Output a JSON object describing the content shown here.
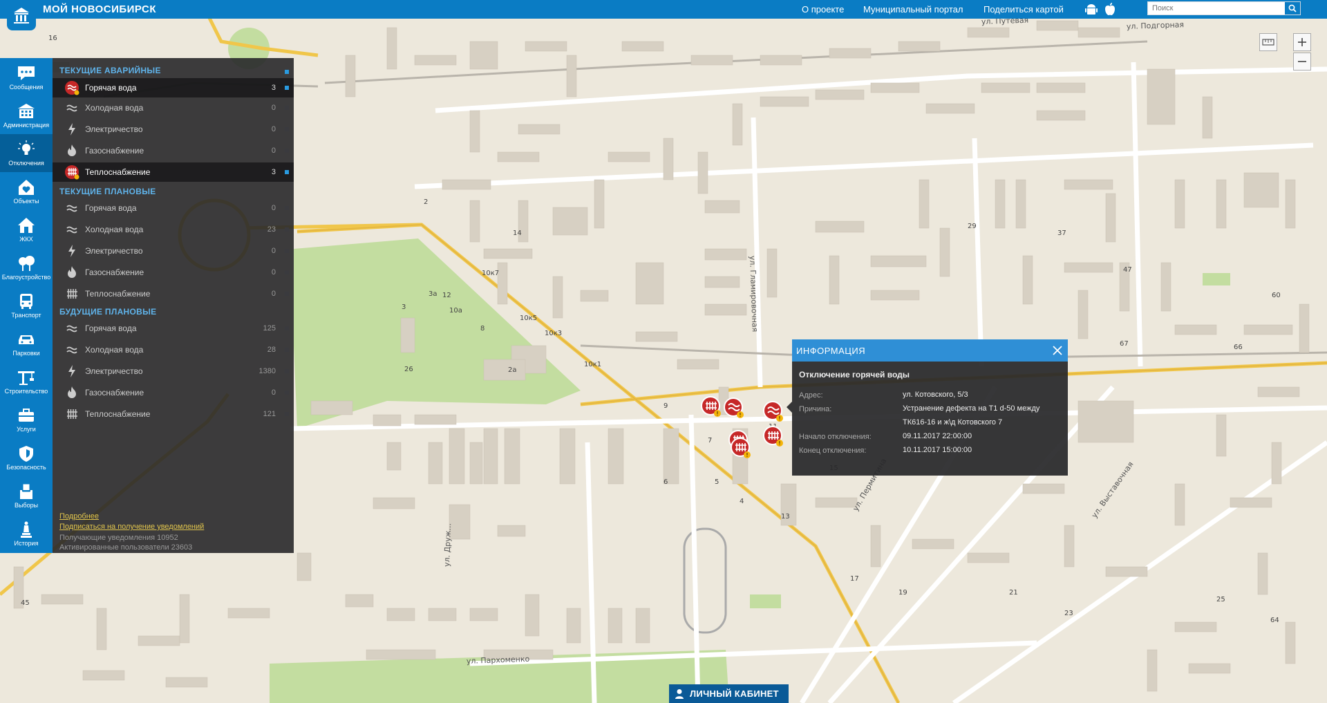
{
  "app": {
    "title": "МОЙ НОВОСИБИРСК"
  },
  "topnav": {
    "about": "О проекте",
    "portal": "Муниципальный портал",
    "share": "Поделиться картой"
  },
  "search": {
    "placeholder": "Поиск"
  },
  "sidebar": {
    "items": [
      {
        "label": "Сообщения",
        "icon": "chat-icon"
      },
      {
        "label": "Администрация",
        "icon": "building-icon"
      },
      {
        "label": "Отключения",
        "icon": "lightbulb-icon",
        "active": true
      },
      {
        "label": "Объекты",
        "icon": "house-heart-icon"
      },
      {
        "label": "ЖКХ",
        "icon": "house-icon"
      },
      {
        "label": "Благоустройство",
        "icon": "tree-icon"
      },
      {
        "label": "Транспорт",
        "icon": "bus-icon"
      },
      {
        "label": "Парковки",
        "icon": "car-icon"
      },
      {
        "label": "Строительство",
        "icon": "crane-icon"
      },
      {
        "label": "Услуги",
        "icon": "briefcase-icon"
      },
      {
        "label": "Безопасность",
        "icon": "shield-icon"
      },
      {
        "label": "Выборы",
        "icon": "ballot-icon"
      },
      {
        "label": "История",
        "icon": "monument-icon"
      }
    ]
  },
  "panel": {
    "current_emergency": {
      "title": "ТЕКУЩИЕ АВАРИЙНЫЕ",
      "rows": [
        {
          "label": "Горячая вода",
          "count": "3"
        },
        {
          "label": "Холодная вода",
          "count": "0"
        },
        {
          "label": "Электричество",
          "count": "0"
        },
        {
          "label": "Газоснабжение",
          "count": "0"
        },
        {
          "label": "Теплоснабжение",
          "count": "3"
        }
      ]
    },
    "current_planned": {
      "title": "ТЕКУЩИЕ ПЛАНОВЫЕ",
      "rows": [
        {
          "label": "Горячая вода",
          "count": "0"
        },
        {
          "label": "Холодная вода",
          "count": "23"
        },
        {
          "label": "Электричество",
          "count": "0"
        },
        {
          "label": "Газоснабжение",
          "count": "0"
        },
        {
          "label": "Теплоснабжение",
          "count": "0"
        }
      ]
    },
    "future_planned": {
      "title": "БУДУЩИЕ ПЛАНОВЫЕ",
      "rows": [
        {
          "label": "Горячая вода",
          "count": "125"
        },
        {
          "label": "Холодная вода",
          "count": "28"
        },
        {
          "label": "Электричество",
          "count": "1380"
        },
        {
          "label": "Газоснабжение",
          "count": "0"
        },
        {
          "label": "Теплоснабжение",
          "count": "121"
        }
      ]
    },
    "more_link": "Подробнее",
    "subscribe_link": "Подписаться на получение уведомлений",
    "receivers": "Получающие уведомления 10952",
    "active_users": "Активированные пользователи 23603"
  },
  "popup": {
    "header": "ИНФОРМАЦИЯ",
    "event": "Отключение горячей воды",
    "address_label": "Адрес:",
    "address": "ул. Котовского, 5/3",
    "reason_label": "Причина:",
    "reason": "Устранение дефекта на Т1 d-50 между ТК616-16 и ж\\д Котовского 7",
    "start_label": "Начало отключения:",
    "start": "09.11.2017 22:00:00",
    "end_label": "Конец отключения:",
    "end": "10.11.2017 15:00:00"
  },
  "cabinet": {
    "label": "ЛИЧНЫЙ КАБИНЕТ"
  },
  "map": {
    "streets": [
      "ул. Гламировочная",
      "ул. Пермитина",
      "ул. Выставочная",
      "ул. Пархоменко",
      "ул. Путевая",
      "ул. Подгорная",
      "ул. Друж..."
    ],
    "house_numbers": [
      "16",
      "10к7",
      "10к5",
      "10к3",
      "10к1",
      "2",
      "8",
      "3",
      "14",
      "12",
      "9",
      "7",
      "5",
      "4",
      "6",
      "11",
      "13",
      "15",
      "17",
      "19",
      "21",
      "23",
      "25",
      "2а",
      "3а",
      "10а",
      "26",
      "29",
      "37",
      "45",
      "47",
      "60",
      "64",
      "66",
      "67"
    ]
  },
  "colors": {
    "brand": "#0a7cc4",
    "panel_accent": "#5fb3ea",
    "marker_red": "#c62828",
    "popup_header": "#2f8fd6"
  }
}
